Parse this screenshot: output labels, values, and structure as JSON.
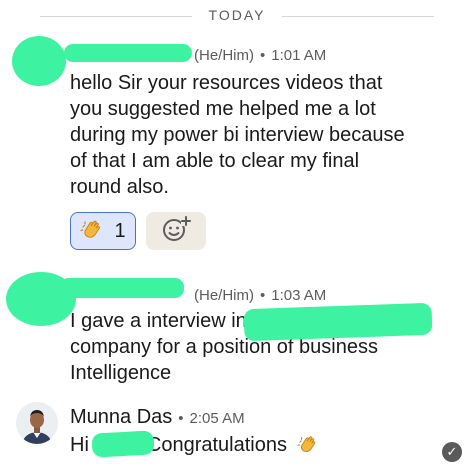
{
  "day_separator": "TODAY",
  "messages": [
    {
      "sender_name": "",
      "pronouns": "(He/Him)",
      "time": "1:01 AM",
      "lines": [
        "hello Sir your resources videos that",
        "you suggested me helped me a lot",
        "during my power bi interview because",
        "of that I am able to clear my final",
        "round also."
      ],
      "reactions": [
        {
          "emoji": "clapping-hands",
          "count": "1",
          "active": true
        }
      ],
      "add_reaction_icon": "add-emoji-icon"
    },
    {
      "sender_name": "",
      "pronouns": "(He/Him)",
      "time": "1:03 AM",
      "lines": [
        "I gave a interview in",
        "company for a position of business",
        "Intelligence"
      ]
    },
    {
      "sender_name": "Munna Das",
      "time": "2:05 AM",
      "greeting": "Hi",
      "text_after": "Congratulations",
      "emoji": "clapping-hands",
      "status_icon": "sent-check-icon"
    }
  ],
  "colors": {
    "redaction": "#3df3a1",
    "reaction_active_bg": "#dde6fb",
    "reaction_active_border": "#4a72c9",
    "add_reaction_bg": "#efeae2"
  }
}
